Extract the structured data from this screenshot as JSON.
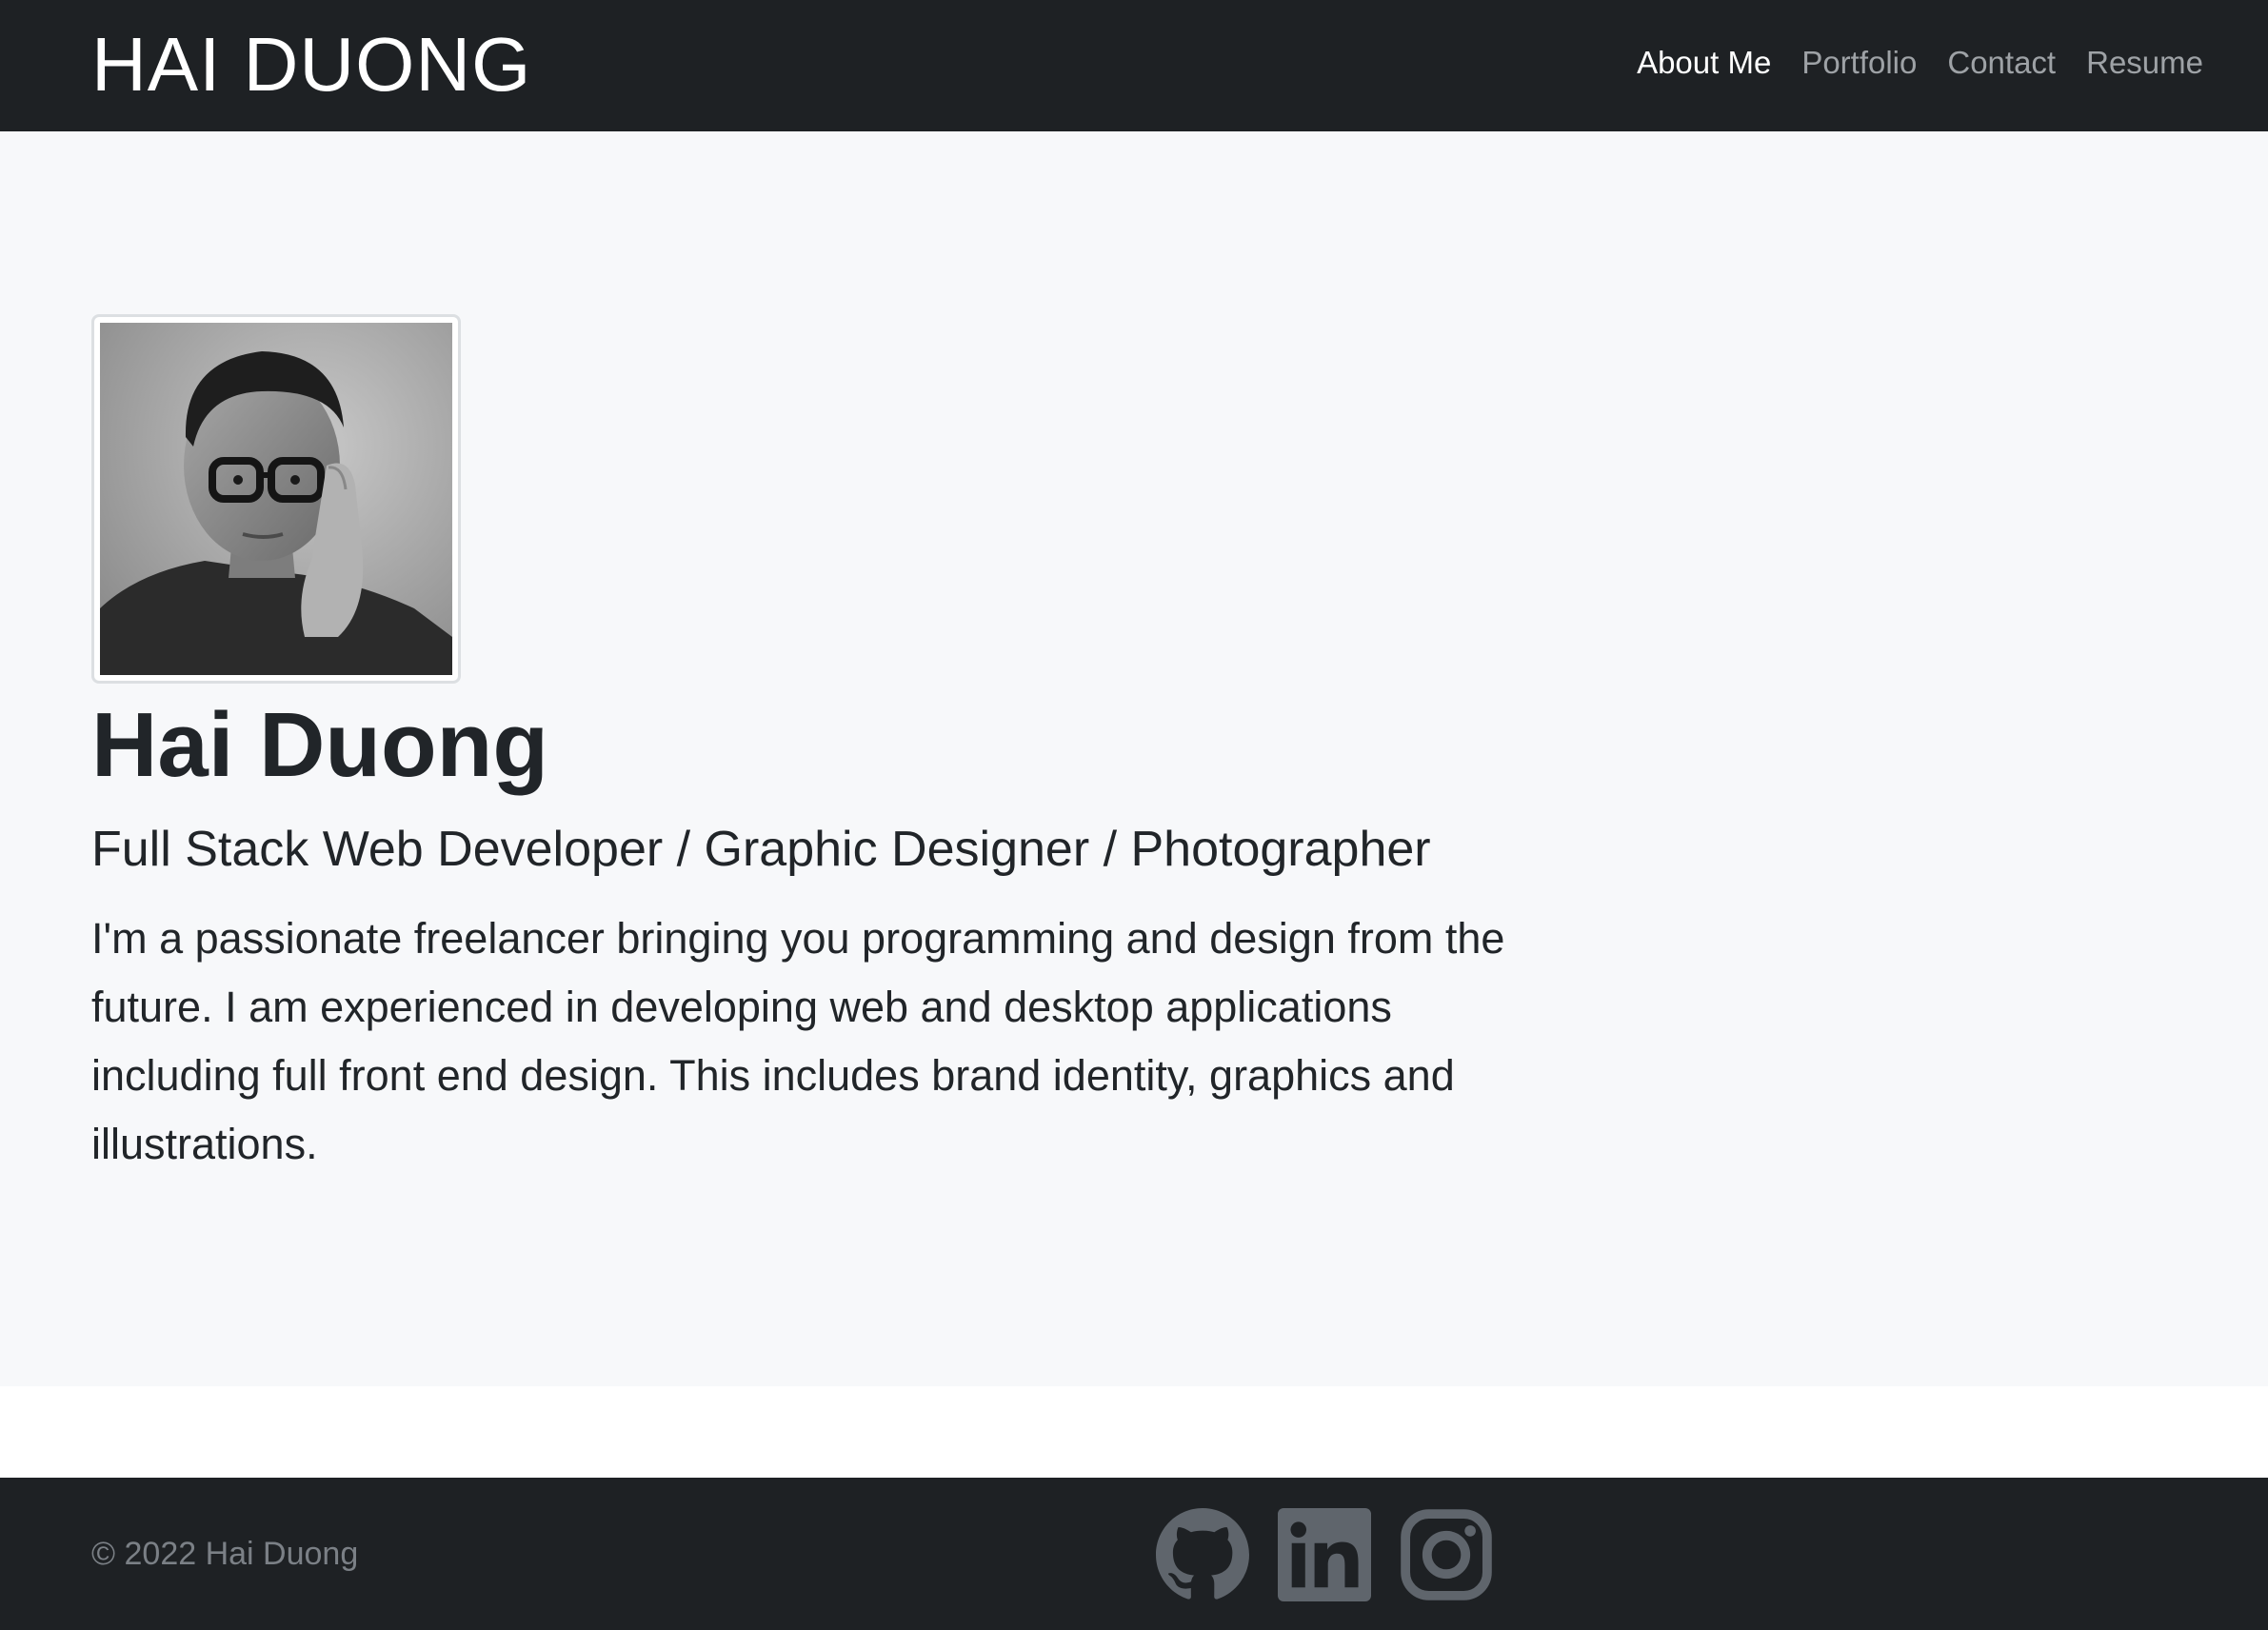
{
  "navbar": {
    "brand": "HAI DUONG",
    "links": [
      {
        "label": "About Me",
        "active": true
      },
      {
        "label": "Portfolio",
        "active": false
      },
      {
        "label": "Contact",
        "active": false
      },
      {
        "label": "Resume",
        "active": false
      }
    ]
  },
  "hero": {
    "name": "Hai Duong",
    "tagline": "Full Stack Web Developer / Graphic Designer / Photographer",
    "bio": "I'm a passionate freelancer bringing you programming and design from the future. I am experienced in developing web and desktop applications including full front end design. This includes brand identity, graphics and illustrations."
  },
  "footer": {
    "copyright": "© 2022 Hai Duong",
    "social": [
      {
        "icon": "github-icon"
      },
      {
        "icon": "linkedin-icon"
      },
      {
        "icon": "instagram-icon"
      }
    ]
  },
  "colors": {
    "dark": "#1e2124",
    "hero_bg": "#f7f8fa",
    "text": "#212529",
    "muted": "#7b8086",
    "icon": "#5f656c"
  }
}
